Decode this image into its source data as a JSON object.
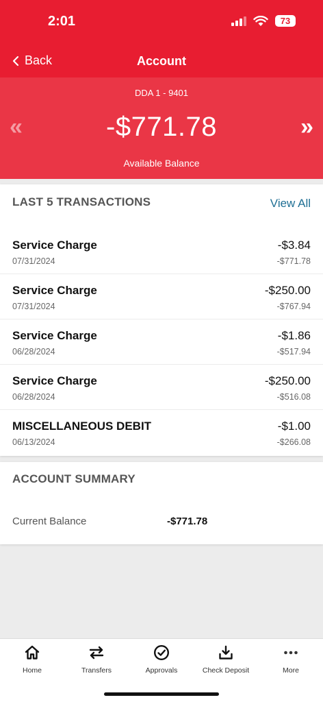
{
  "status_bar": {
    "time": "2:01",
    "battery": "73"
  },
  "nav": {
    "back_label": "Back",
    "title": "Account"
  },
  "account": {
    "id": "DDA 1 - 9401",
    "balance": "-$771.78",
    "balance_label": "Available Balance",
    "prev_symbol": "«",
    "next_symbol": "»"
  },
  "transactions": {
    "title": "LAST 5 TRANSACTIONS",
    "view_all": "View All",
    "items": [
      {
        "name": "Service Charge",
        "date": "07/31/2024",
        "amount": "-$3.84",
        "balance": "-$771.78"
      },
      {
        "name": "Service Charge",
        "date": "07/31/2024",
        "amount": "-$250.00",
        "balance": "-$767.94"
      },
      {
        "name": "Service Charge",
        "date": "06/28/2024",
        "amount": "-$1.86",
        "balance": "-$517.94"
      },
      {
        "name": "Service Charge",
        "date": "06/28/2024",
        "amount": "-$250.00",
        "balance": "-$516.08"
      },
      {
        "name": "MISCELLANEOUS DEBIT",
        "date": "06/13/2024",
        "amount": "-$1.00",
        "balance": "-$266.08"
      }
    ]
  },
  "summary": {
    "title": "ACCOUNT SUMMARY",
    "current_balance_label": "Current Balance",
    "current_balance_value": "-$771.78"
  },
  "tabbar": {
    "items": [
      {
        "label": "Home",
        "icon": "home-icon"
      },
      {
        "label": "Transfers",
        "icon": "transfer-arrows-icon"
      },
      {
        "label": "Approvals",
        "icon": "check-circle-icon"
      },
      {
        "label": "Check Deposit",
        "icon": "download-tray-icon"
      },
      {
        "label": "More",
        "icon": "more-dots-icon"
      }
    ]
  },
  "colors": {
    "brand_red": "#e81d31",
    "banner_red": "#ea3646",
    "link_blue": "#1f6f94"
  }
}
